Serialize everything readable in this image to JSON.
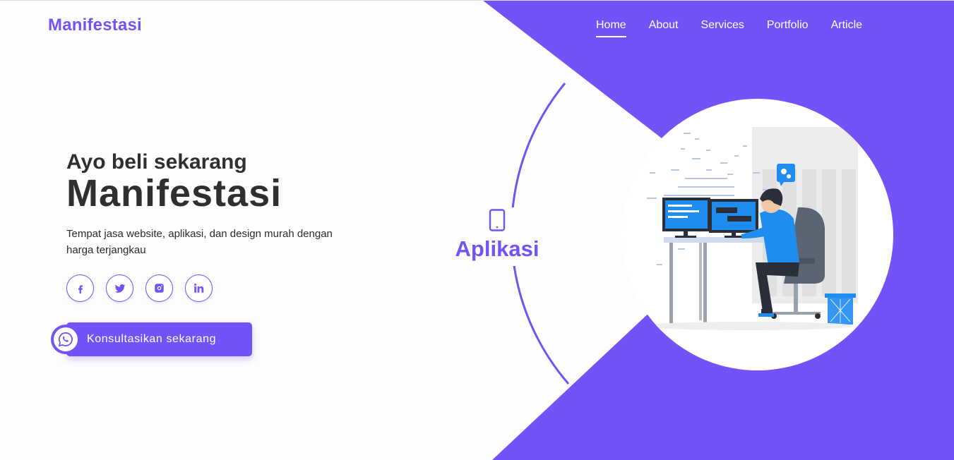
{
  "brand": {
    "logo_text": "Manifestasi"
  },
  "nav": {
    "items": [
      {
        "label": "Home",
        "active": true
      },
      {
        "label": "About",
        "active": false
      },
      {
        "label": "Services",
        "active": false
      },
      {
        "label": "Portfolio",
        "active": false
      },
      {
        "label": "Article",
        "active": false
      }
    ]
  },
  "hero": {
    "subtitle": "Ayo beli sekarang",
    "title": "Manifestasi",
    "description": "Tempat jasa website, aplikasi, dan design murah dengan harga terjangkau"
  },
  "socials": [
    {
      "icon": "facebook-icon"
    },
    {
      "icon": "twitter-icon"
    },
    {
      "icon": "instagram-icon"
    },
    {
      "icon": "linkedin-icon"
    }
  ],
  "cta": {
    "label": "Konsultasikan sekarang",
    "icon": "whatsapp-icon"
  },
  "service_label": {
    "text": "Aplikasi",
    "icon": "smartphone-icon"
  },
  "colors": {
    "accent": "#7352f8",
    "text_dark": "#2f2f2f",
    "background": "#fdfdfd"
  }
}
